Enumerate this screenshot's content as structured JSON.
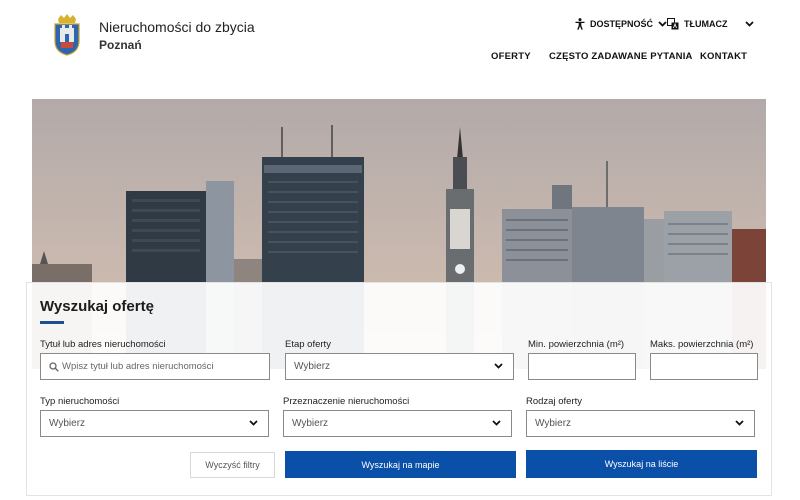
{
  "brand": {
    "title": "Nieruchomości do zbycia",
    "subtitle": "Poznań"
  },
  "utility": {
    "accessibility": "DOSTĘPNOŚĆ",
    "translator": "TŁUMACZ"
  },
  "nav": {
    "items": [
      "OFERTY",
      "CZĘSTO ZADAWANE PYTANIA",
      "KONTAKT"
    ]
  },
  "search": {
    "title": "Wyszukaj ofertę",
    "fields": {
      "title_address": {
        "label": "Tytuł lub adres nieruchomości",
        "placeholder": "Wpisz tytuł lub adres nieruchomości"
      },
      "stage": {
        "label": "Etap oferty",
        "value": "Wybierz"
      },
      "min_area": {
        "label": "Min. powierzchnia (m²)",
        "value": ""
      },
      "max_area": {
        "label": "Maks. powierzchnia (m²)",
        "value": ""
      },
      "property_type": {
        "label": "Typ nieruchomości",
        "value": "Wybierz"
      },
      "purpose": {
        "label": "Przeznaczenie nieruchomości",
        "value": "Wybierz"
      },
      "offer_type": {
        "label": "Rodzaj oferty",
        "value": "Wybierz"
      }
    },
    "buttons": {
      "clear": "Wyczyść filtry",
      "map": "Wyszukaj na mapie",
      "list": "Wyszukaj na liście"
    }
  },
  "colors": {
    "primary": "#0a4fa8",
    "accent_underline": "#1e4f93"
  }
}
